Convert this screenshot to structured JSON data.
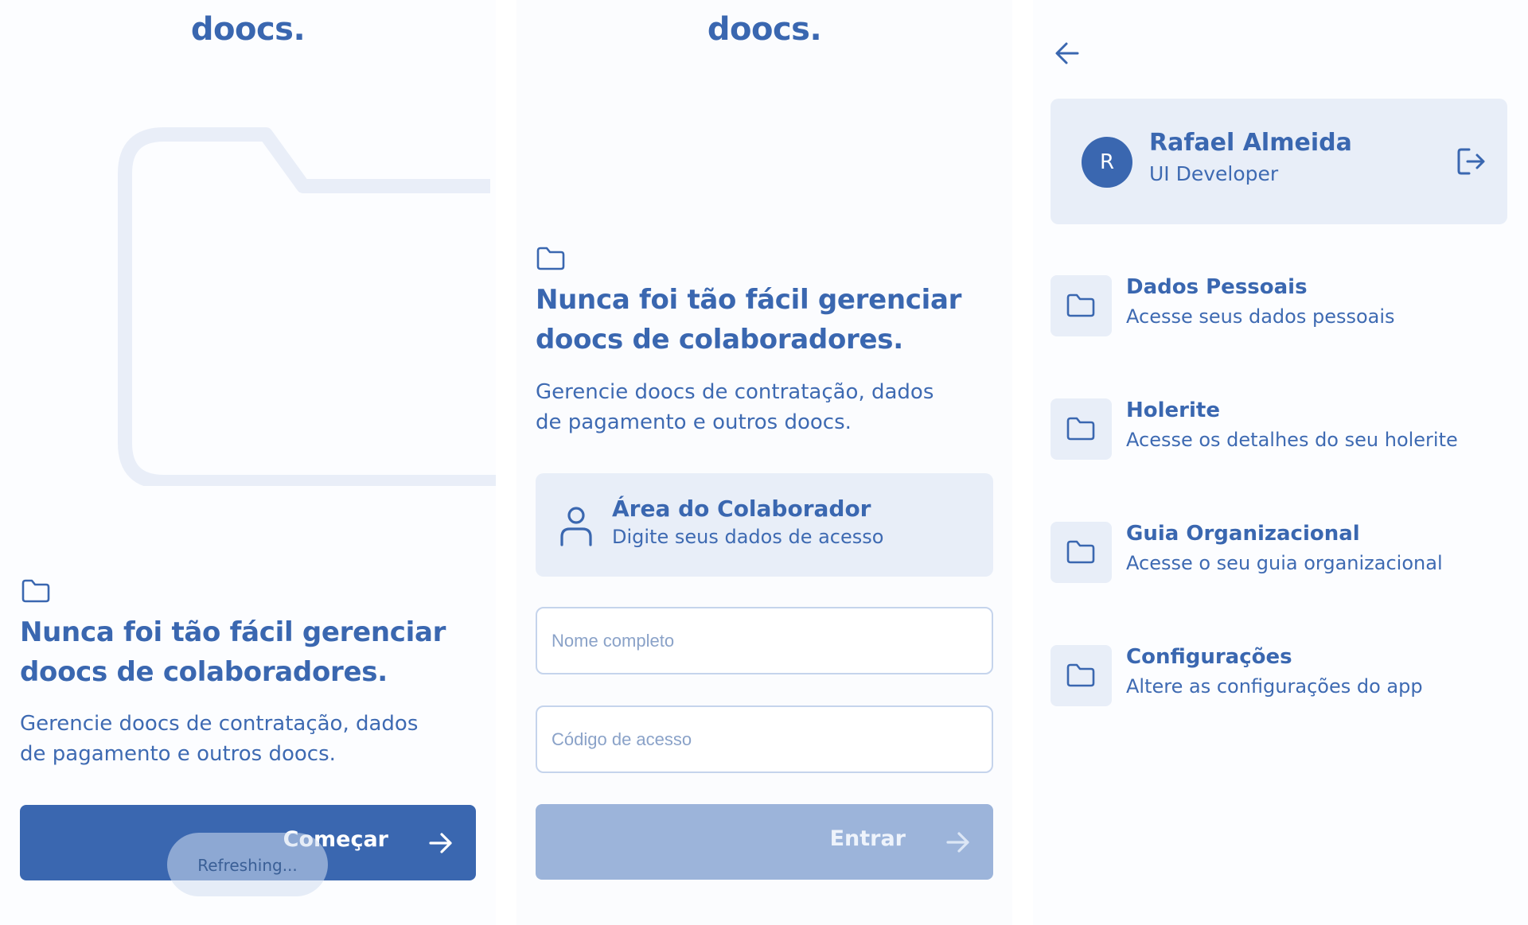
{
  "colors": {
    "primary": "#3a67b0",
    "card_bg": "#e8eef8",
    "disabled": "#9cb4da"
  },
  "screen1": {
    "logo": "doocs.",
    "headline_line1": "Nunca foi tão fácil gerenciar",
    "headline_line2": "doocs de colaboradores.",
    "subtext_line1": "Gerencie doocs de contratação, dados",
    "subtext_line2": "de pagamento e outros doocs.",
    "start_button": "Começar",
    "toast": "Refreshing..."
  },
  "screen2": {
    "logo": "doocs.",
    "headline_line1": "Nunca foi tão fácil gerenciar",
    "headline_line2": "doocs de colaboradores.",
    "subtext_line1": "Gerencie doocs de contratação, dados",
    "subtext_line2": "de pagamento e outros doocs.",
    "card_title": "Área do Colaborador",
    "card_subtitle": "Digite seus dados de acesso",
    "name_placeholder": "Nome completo",
    "code_placeholder": "Código de acesso",
    "enter_button": "Entrar"
  },
  "screen3": {
    "avatar_initial": "R",
    "user_name": "Rafael Almeida",
    "user_role": "UI Developer",
    "menu": [
      {
        "title": "Dados Pessoais",
        "subtitle": "Acesse seus dados pessoais",
        "icon": "folder-icon"
      },
      {
        "title": "Holerite",
        "subtitle": "Acesse os detalhes do seu holerite",
        "icon": "folder-icon"
      },
      {
        "title": "Guia Organizacional",
        "subtitle": "Acesse o seu guia organizacional",
        "icon": "folder-icon"
      },
      {
        "title": "Configurações",
        "subtitle": "Altere as configurações do app",
        "icon": "folder-icon"
      }
    ]
  }
}
